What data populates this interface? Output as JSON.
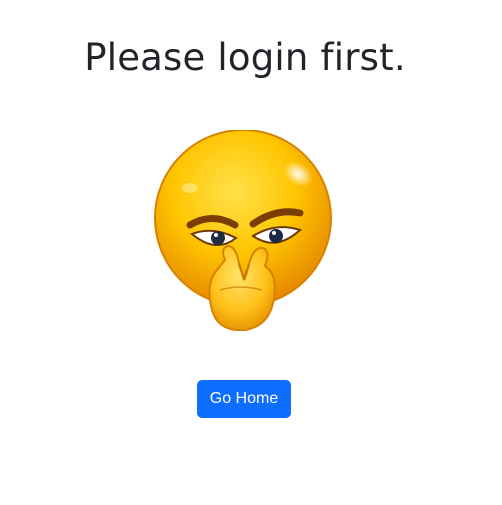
{
  "page": {
    "title": "Please login first.",
    "button_label": "Go Home"
  },
  "illustration": {
    "icon": "suspicious-emoji-icon"
  },
  "colors": {
    "button_bg": "#0d6efd",
    "title_text": "#212529",
    "emoji_face": "#f7b500"
  }
}
